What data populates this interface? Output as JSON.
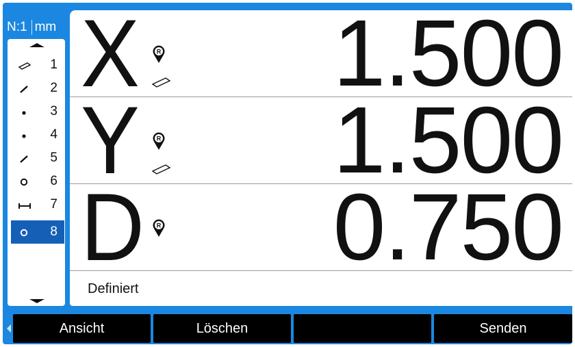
{
  "header": {
    "channel_label": "N:1",
    "unit_label": "mm"
  },
  "feature_list": {
    "items": [
      {
        "number": "1",
        "icon": "parallelogram-icon",
        "selected": false
      },
      {
        "number": "2",
        "icon": "line-icon",
        "selected": false
      },
      {
        "number": "3",
        "icon": "point-icon",
        "selected": false
      },
      {
        "number": "4",
        "icon": "point-icon",
        "selected": false
      },
      {
        "number": "5",
        "icon": "line-icon",
        "selected": false
      },
      {
        "number": "6",
        "icon": "circle-icon",
        "selected": false
      },
      {
        "number": "7",
        "icon": "distance-icon",
        "selected": false
      },
      {
        "number": "8",
        "icon": "circle-icon",
        "selected": true
      }
    ]
  },
  "readouts": [
    {
      "axis": "X",
      "value": "1.500",
      "reference_icon": "reference-pin-icon",
      "feature_icon": "parallelogram-icon"
    },
    {
      "axis": "Y",
      "value": "1.500",
      "reference_icon": "reference-pin-icon",
      "feature_icon": "parallelogram-icon"
    },
    {
      "axis": "D",
      "value": "0.750",
      "reference_icon": "reference-pin-icon"
    }
  ],
  "reference_pin_letter": "R",
  "status": {
    "text": "Definiert"
  },
  "softkeys": [
    {
      "label": "Ansicht"
    },
    {
      "label": "Löschen"
    },
    {
      "label": ""
    },
    {
      "label": "Senden"
    }
  ],
  "colors": {
    "frame": "#1b87e0",
    "selected_item": "#1560b6",
    "softkey": "#000000"
  }
}
